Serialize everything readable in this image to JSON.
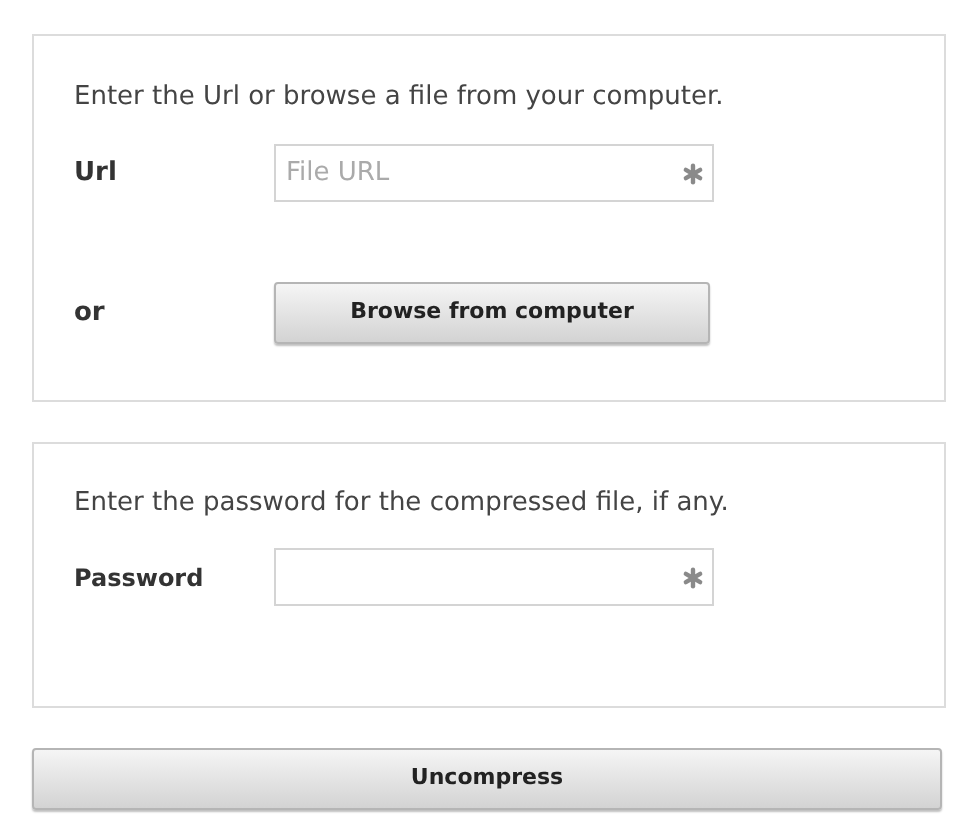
{
  "source_panel": {
    "instruction": "Enter the Url or browse a file from your computer.",
    "url_label": "Url",
    "url_field": {
      "placeholder": "File URL",
      "required": true
    },
    "or_label": "or",
    "browse_button": "Browse from computer"
  },
  "password_panel": {
    "instruction": "Enter the password for the compressed file, if any.",
    "password_label": "Password",
    "password_field": {
      "required": true
    }
  },
  "uncompress_button": "Uncompress"
}
